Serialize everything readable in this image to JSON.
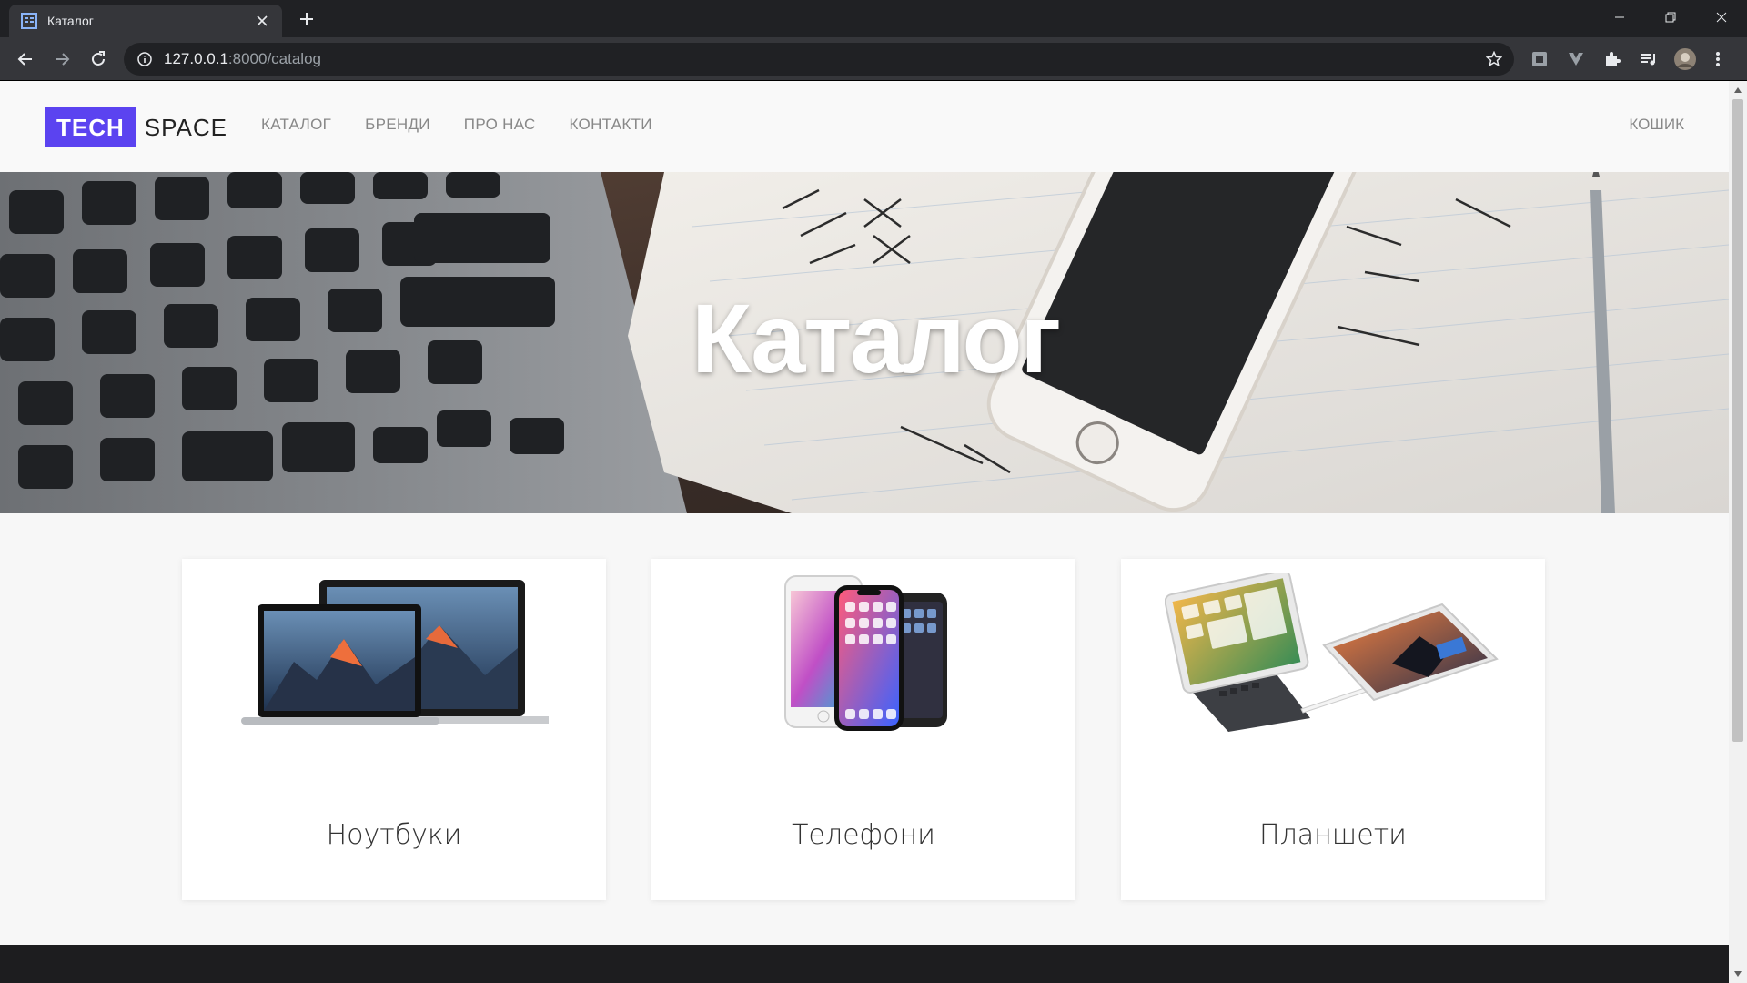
{
  "browser": {
    "tab_title": "Каталог",
    "url_host": "127.0.0.1",
    "url_path": ":8000/catalog"
  },
  "site": {
    "logo_tech": "TECH",
    "logo_space": "SPACE",
    "nav": [
      "КАТАЛОГ",
      "БРЕНДИ",
      "ПРО НАС",
      "КОНТАКТИ"
    ],
    "cart": "КОШИК",
    "hero_title": "Каталог",
    "accent_color": "#5b43f0",
    "categories": [
      {
        "title": "Ноутбуки",
        "icon": "laptop-image"
      },
      {
        "title": "Телефони",
        "icon": "phone-image"
      },
      {
        "title": "Планшети",
        "icon": "tablet-image"
      }
    ]
  }
}
